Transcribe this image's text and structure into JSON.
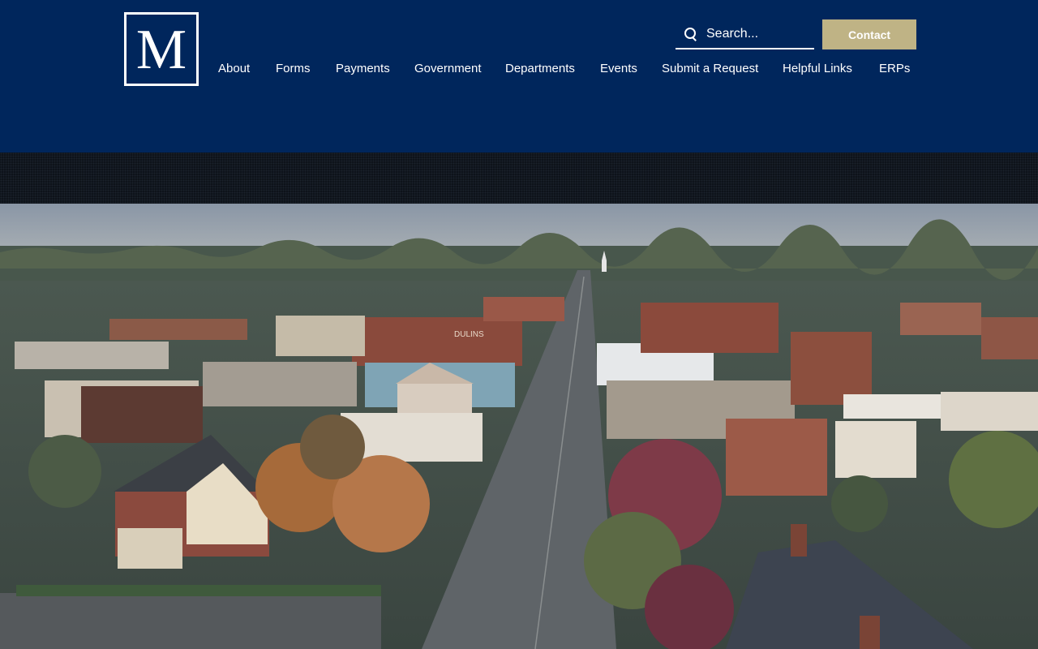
{
  "header": {
    "logo_letter": "M",
    "search": {
      "placeholder": "Search..."
    },
    "contact_label": "Contact",
    "nav": [
      "About",
      "Forms",
      "Payments",
      "Government",
      "Departments",
      "Events",
      "Submit a Request",
      "Helpful Links",
      "ERPs"
    ]
  },
  "hero": {
    "sign_text": "DULINS"
  },
  "colors": {
    "header_bg": "#00265c",
    "contact_bg": "#bfb385",
    "band_bg": "#0e131a"
  }
}
